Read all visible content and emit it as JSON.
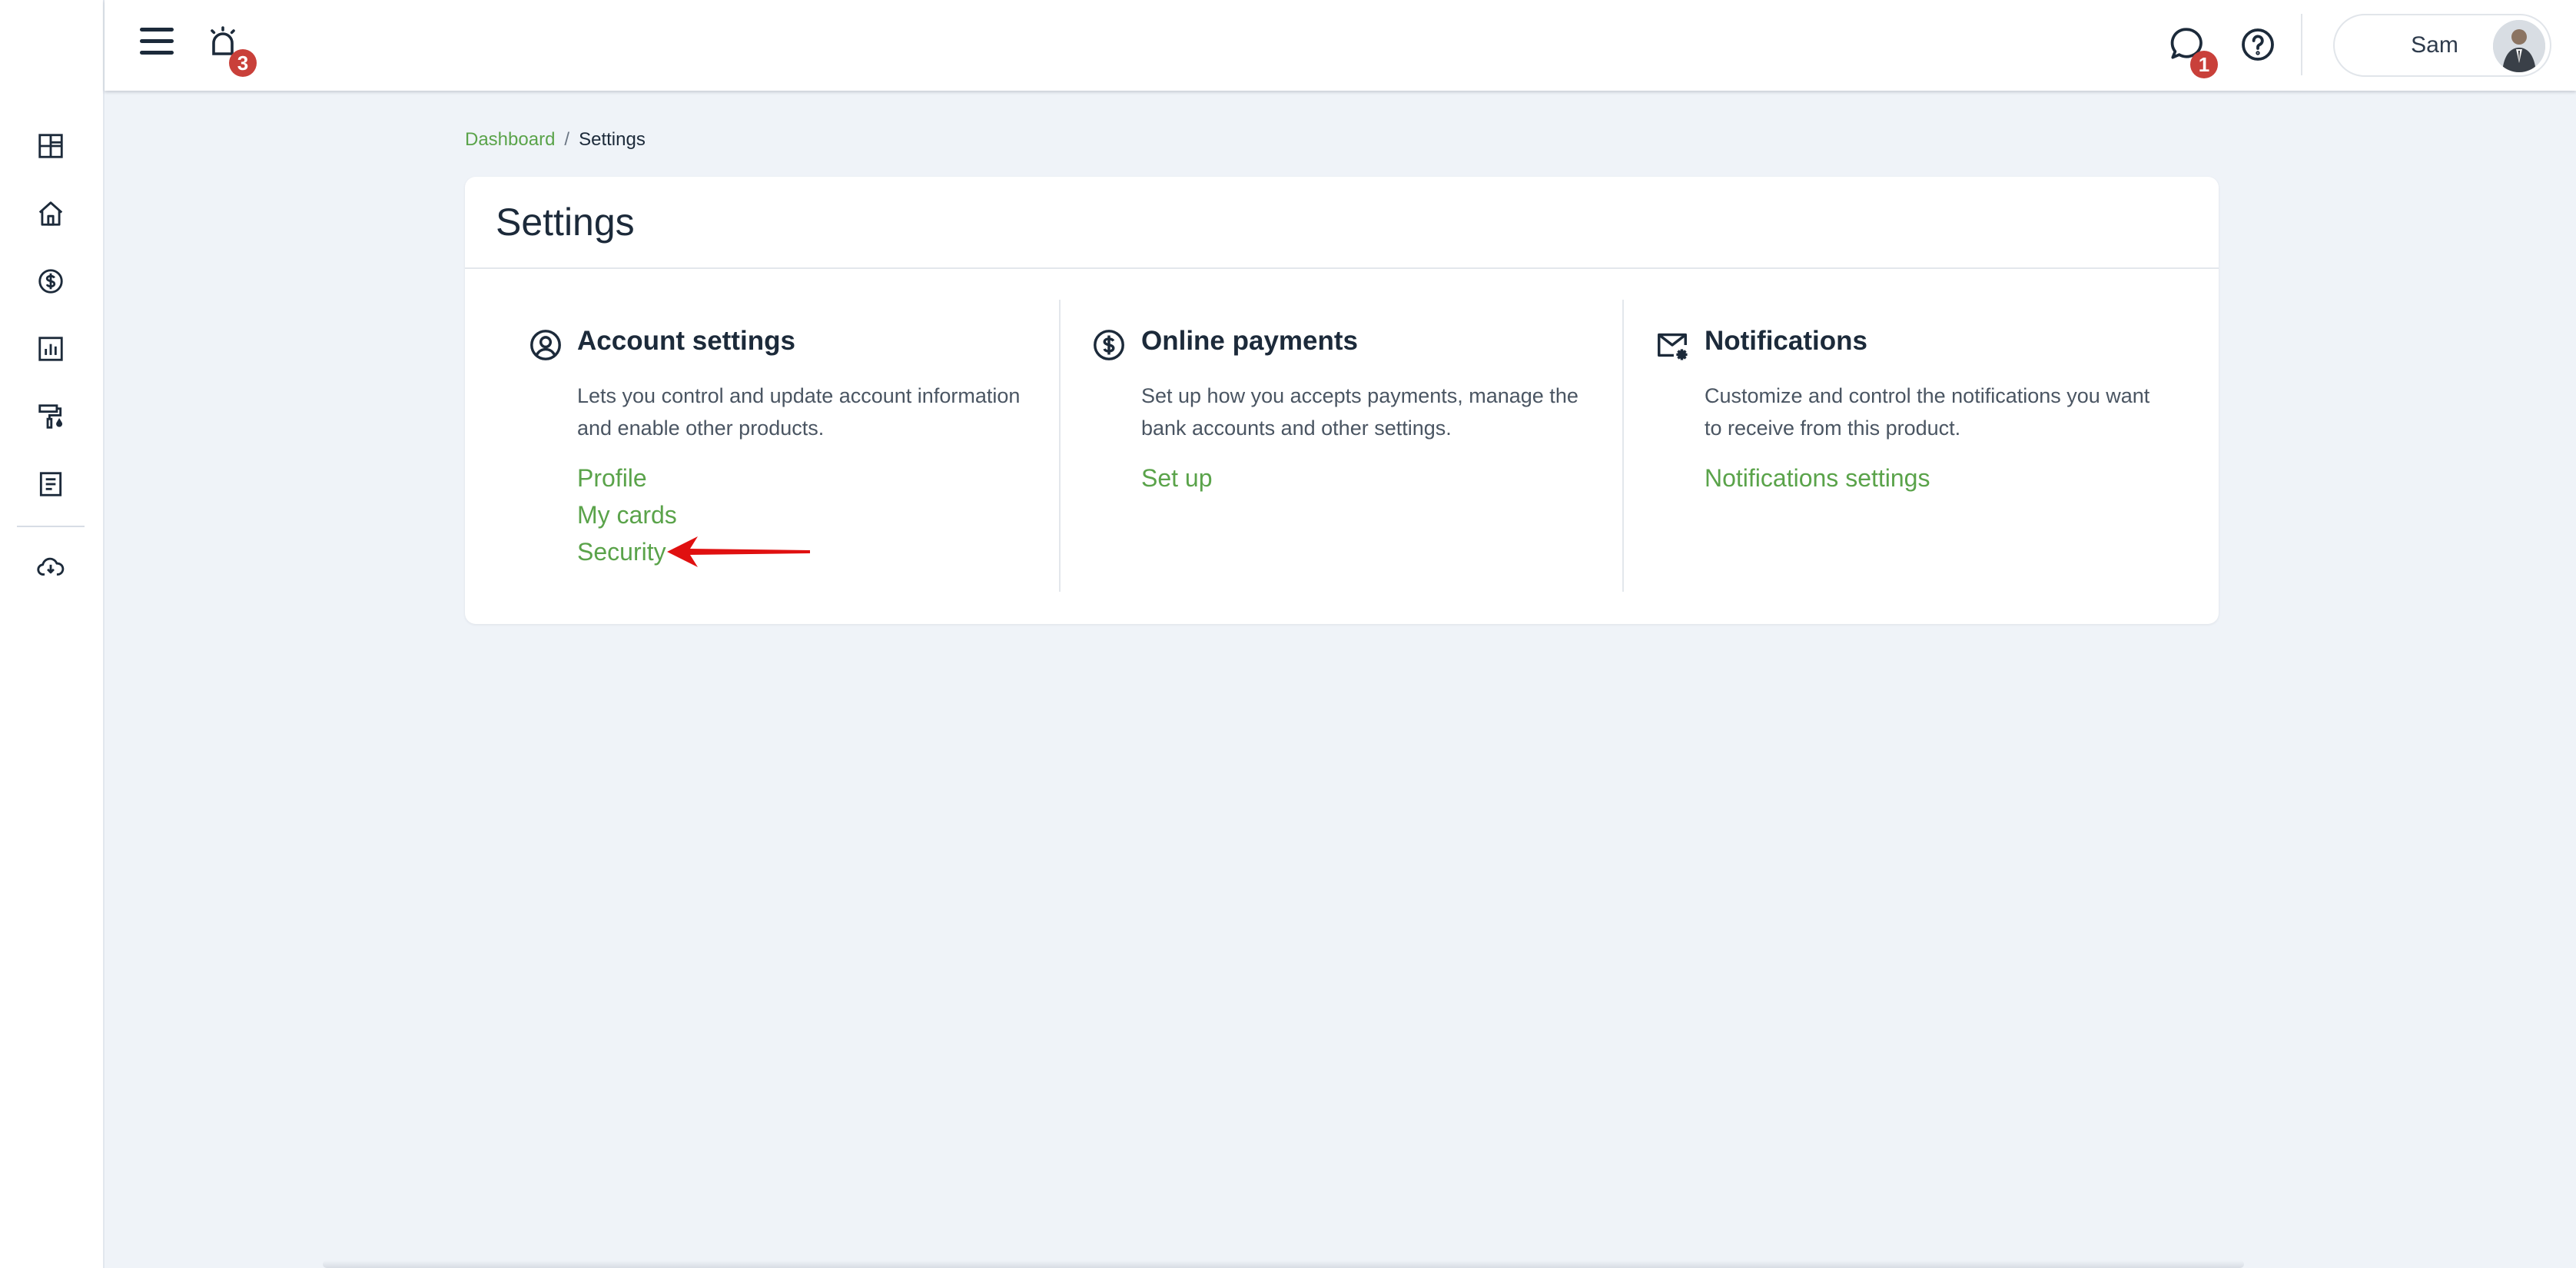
{
  "header": {
    "alarm_badge": "3",
    "chat_badge": "1",
    "user_name": "Sam"
  },
  "breadcrumb": {
    "link": "Dashboard",
    "separator": "/",
    "current": "Settings"
  },
  "settings": {
    "title": "Settings",
    "sections": [
      {
        "icon": "user-circle-icon",
        "title": "Account settings",
        "description": "Lets you control and update account information and enable other products.",
        "links": [
          "Profile",
          "My cards",
          "Security"
        ]
      },
      {
        "icon": "dollar-circle-icon",
        "title": "Online payments",
        "description": "Set up how you accepts payments, manage the bank accounts and other settings.",
        "links": [
          "Set up"
        ]
      },
      {
        "icon": "mail-gear-icon",
        "title": "Notifications",
        "description": "Customize and control the notifications you want to receive from this product.",
        "links": [
          "Notifications settings"
        ]
      }
    ]
  },
  "sidebar_icons": [
    "dashboard-grid-icon",
    "home-icon",
    "dollar-circle-icon",
    "bar-chart-icon",
    "paint-roller-icon",
    "document-icon",
    "cloud-download-icon"
  ],
  "colors": {
    "accent_green": "#5aa34a",
    "badge_red": "#c9403a",
    "text_dark": "#1c2a3a",
    "background": "#eff3f8",
    "annotation_arrow": "#e01010"
  }
}
